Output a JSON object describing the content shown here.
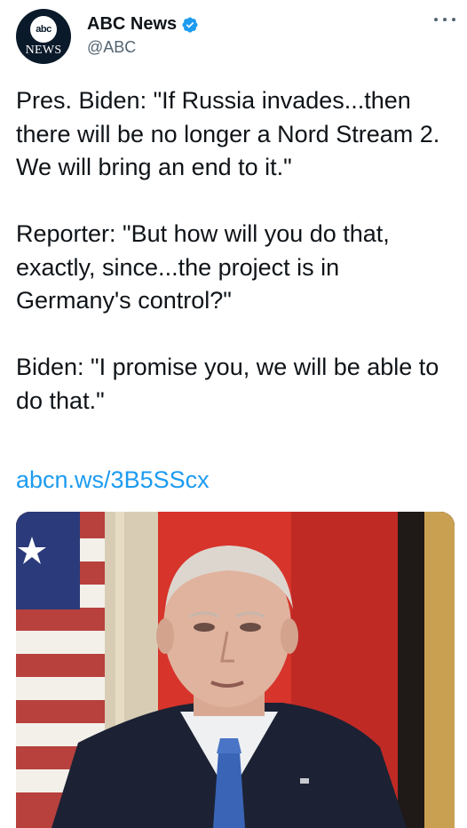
{
  "author": {
    "display_name": "ABC News",
    "handle": "@ABC",
    "avatar_top_text": "abc",
    "avatar_bottom_text": "NEWS",
    "verified": true,
    "verified_color": "#1d9bf0"
  },
  "tweet": {
    "text": "Pres. Biden: \"If Russia invades...then there will be no longer a Nord Stream 2. We will bring an end to it.\"\n\nReporter: \"But how will you do that, exactly, since...the project is in Germany's control?\"\n\nBiden: \"I promise you, we will be able to do that.\"",
    "link": "abcn.ws/3B5SScx",
    "link_color": "#1d9bf0"
  },
  "media": {
    "icons": [
      "flag-us",
      "flag-germany",
      "person-at-podium"
    ]
  },
  "icons": {
    "more": "more-dots-icon",
    "verified": "verified-badge-icon"
  }
}
